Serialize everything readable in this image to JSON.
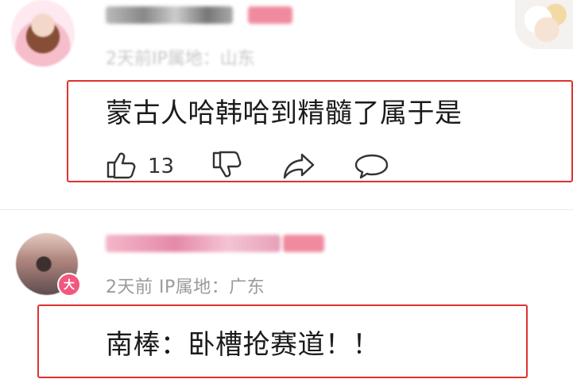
{
  "comment1": {
    "meta_blurred": "2天前IP属地：山东",
    "text": "蒙古人哈韩哈到精髓了属于是",
    "like_count": "13",
    "icons": [
      "thumbs-up-icon",
      "thumbs-down-icon",
      "share-icon",
      "comment-bubble-icon"
    ]
  },
  "comment2": {
    "badge": "大",
    "meta": "2天前 IP属地：广东",
    "text": "南棒：卧槽抢赛道！！"
  },
  "colors": {
    "highlight_box": "#e0312f",
    "blur_name_pink": "#f08b9f",
    "meta_gray": "#9a9a9a",
    "badge_pink": "#f05880"
  }
}
